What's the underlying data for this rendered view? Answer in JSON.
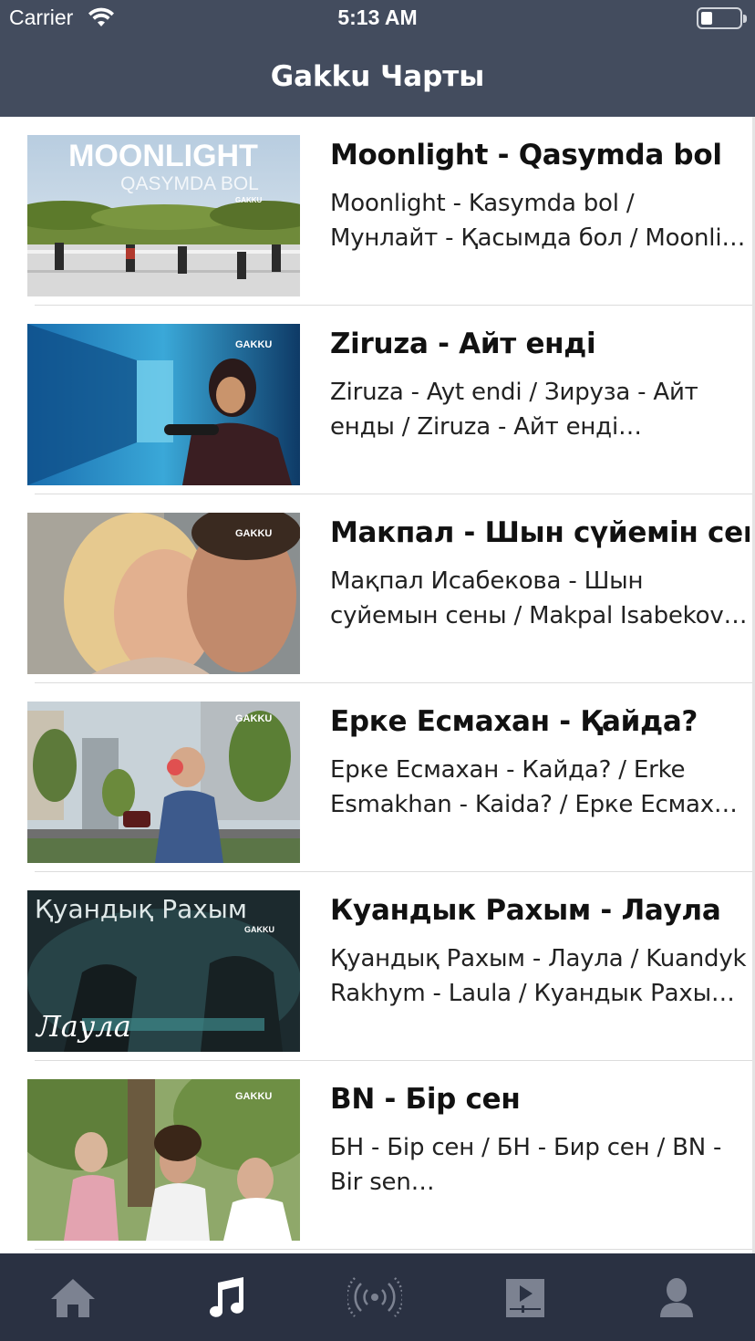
{
  "status_bar": {
    "carrier": "Carrier",
    "time": "5:13 AM"
  },
  "nav": {
    "title": "Gakku Чарты"
  },
  "items": [
    {
      "title": "Moonlight - Qasymda bol",
      "desc_line1": "Moonlight - Kasymda bol /",
      "desc_line2": "Мунлайт - Қасымда бол / Moonlight - Kasymda bol",
      "thumb_title": "MOONLIGHT",
      "thumb_subtitle": "QASYMDA BOL",
      "thumb_logo": "GAKKU"
    },
    {
      "title": "Ziruza - Айт енді",
      "desc_line1": "Ziruza - Ayt endi / Зируза - Айт",
      "desc_line2": "енды / Ziruza - Айт енді…",
      "thumb_logo": "GAKKU"
    },
    {
      "title": "Макпал - Шын сүйемін сені",
      "desc_line1": "Мақпал Исабекова - Шын",
      "desc_line2": "суйемын сены / Makpal Isabekova - Shyn",
      "thumb_logo": "GAKKU"
    },
    {
      "title": "Ерке Есмахан - Қайда?",
      "desc_line1": "Ерке Есмахан - Кайда? / Erke",
      "desc_line2": "Esmakhan - Kaida? / Ерке Есмахан - Қайда?",
      "thumb_logo": "GAKKU"
    },
    {
      "title": "Куандык Рахым - Лаула",
      "desc_line1": "Қуандық Рахым - Лаула / Kuandyk",
      "desc_line2": "Rakhym - Laula / Куандык Рахым - Лаула",
      "thumb_title": "Қуандық Рахым",
      "thumb_script": "Лаула",
      "thumb_logo": "GAKKU"
    },
    {
      "title": "BN - Бір сен",
      "desc_line1": "БН - Бір сен / БН - Бир сен / BN -",
      "desc_line2": "Bir sen…",
      "thumb_logo": "GAKKU"
    }
  ],
  "tabs": [
    {
      "icon": "home-icon",
      "active": false
    },
    {
      "icon": "music-note-icon",
      "active": true
    },
    {
      "icon": "radio-broadcast-icon",
      "active": false
    },
    {
      "icon": "video-player-icon",
      "active": false
    },
    {
      "icon": "profile-icon",
      "active": false
    }
  ],
  "colors": {
    "nav_bg": "#434c5e",
    "tabbar_bg": "#2a3142",
    "tab_inactive": "#7c8291",
    "tab_active": "#ffffff"
  }
}
